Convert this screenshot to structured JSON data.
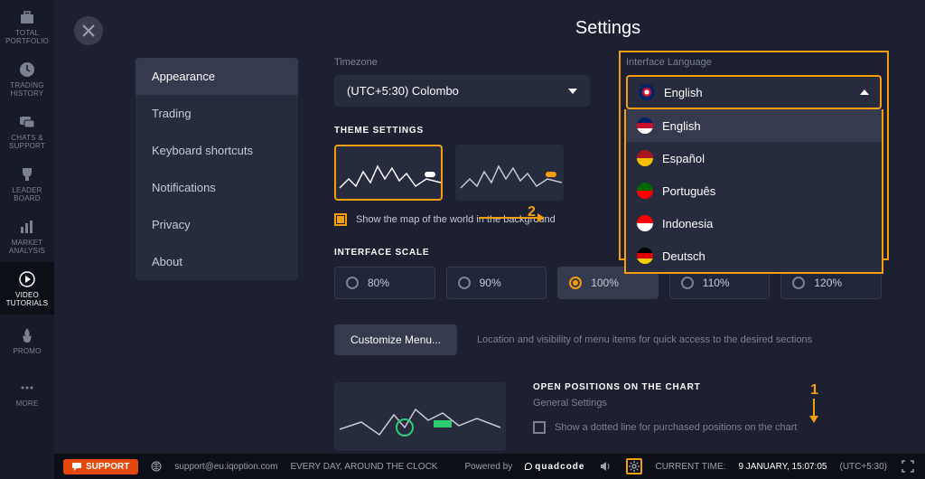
{
  "sidebar": [
    {
      "icon": "briefcase",
      "label": "TOTAL\nPORTFOLIO"
    },
    {
      "icon": "clock",
      "label": "TRADING\nHISTORY"
    },
    {
      "icon": "chat",
      "label": "CHATS &\nSUPPORT"
    },
    {
      "icon": "trophy",
      "label": "LEADER\nBOARD"
    },
    {
      "icon": "bars",
      "label": "MARKET\nANALYSIS"
    },
    {
      "icon": "play",
      "label": "VIDEO\nTUTORIALS",
      "active": true
    },
    {
      "icon": "flame",
      "label": "PROMO"
    },
    {
      "icon": "dots",
      "label": "MORE"
    }
  ],
  "page_title": "Settings",
  "nav": [
    {
      "label": "Appearance",
      "active": true
    },
    {
      "label": "Trading"
    },
    {
      "label": "Keyboard shortcuts"
    },
    {
      "label": "Notifications"
    },
    {
      "label": "Privacy"
    },
    {
      "label": "About"
    }
  ],
  "timezone": {
    "label": "Timezone",
    "value": "(UTC+5:30) Colombo"
  },
  "language": {
    "label": "Interface Language",
    "value": "English",
    "options": [
      {
        "label": "English",
        "flag_colors": [
          "#012169",
          "#c8102e",
          "#fff"
        ],
        "selected": true
      },
      {
        "label": "Español",
        "flag_colors": [
          "#aa151b",
          "#f1bf00"
        ]
      },
      {
        "label": "Português",
        "flag_colors": [
          "#006600",
          "#ff0000"
        ]
      },
      {
        "label": "Indonesia",
        "flag_colors": [
          "#ff0000",
          "#ffffff"
        ]
      },
      {
        "label": "Deutsch",
        "flag_colors": [
          "#000",
          "#dd0000",
          "#ffce00"
        ]
      }
    ]
  },
  "theme_label": "THEME SETTINGS",
  "map_check": "Show the map of the world in the background",
  "scale_label": "INTERFACE SCALE",
  "scales": [
    "80%",
    "90%",
    "100%",
    "110%",
    "120%"
  ],
  "scale_active": 2,
  "customize_btn": "Customize Menu...",
  "customize_hint": "Location and visibility of menu items for quick access to the desired sections",
  "open_pos_label": "OPEN POSITIONS ON THE CHART",
  "open_pos_sub": "General Settings",
  "open_pos_check": "Show a dotted line for purchased positions on the chart",
  "annotation_1": "1",
  "annotation_2": "2",
  "footer": {
    "support": "SUPPORT",
    "email": "support@eu.iqoption.com",
    "tagline": "EVERY DAY, AROUND THE CLOCK",
    "powered": "Powered by",
    "brand": "quadcode",
    "time_label": "CURRENT TIME:",
    "time_value": "9 JANUARY, 15:07:05",
    "tz": "(UTC+5:30)"
  }
}
